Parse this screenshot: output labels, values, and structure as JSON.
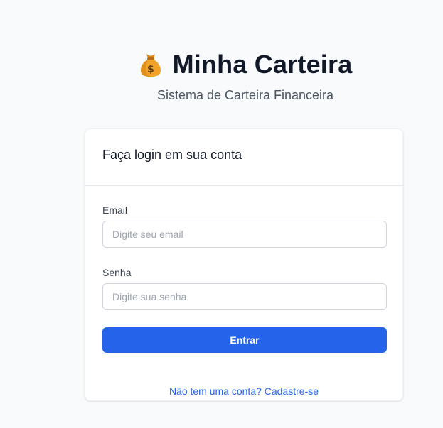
{
  "brand": {
    "title": "Minha Carteira",
    "subtitle": "Sistema de Carteira Financeira",
    "icon": "money-bag-icon"
  },
  "login_card": {
    "heading": "Faça login em sua conta",
    "email": {
      "label": "Email",
      "value": "",
      "placeholder": "Digite seu email"
    },
    "password": {
      "label": "Senha",
      "value": "",
      "placeholder": "Digite sua senha"
    },
    "submit_label": "Entrar",
    "signup_link": "Não tem uma conta? Cadastre-se"
  },
  "colors": {
    "primary": "#2563eb",
    "background": "#f9fafb",
    "title_text": "#111827",
    "muted_text": "#4b5563"
  }
}
